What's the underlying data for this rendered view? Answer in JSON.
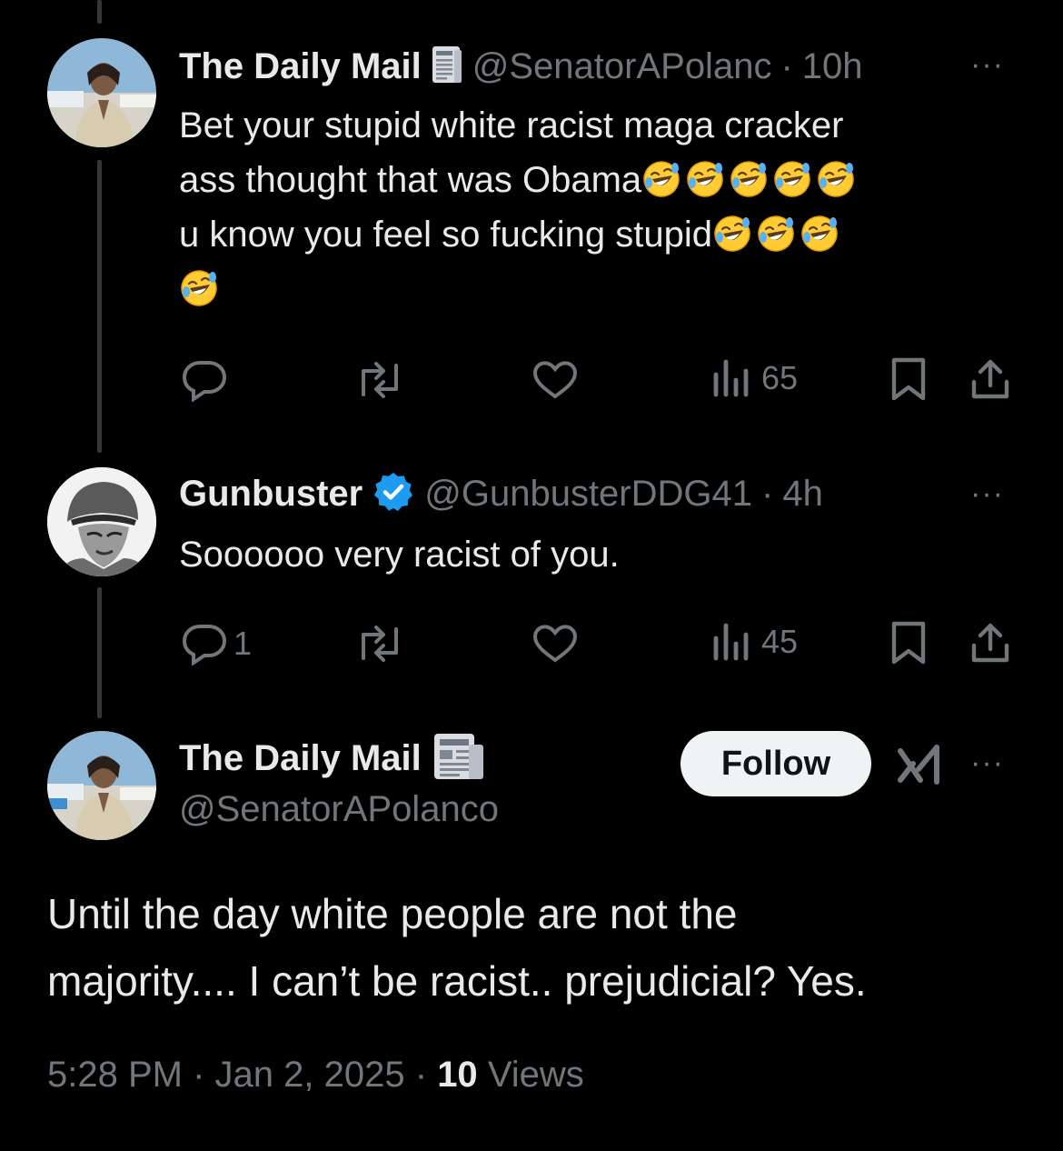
{
  "tweet1": {
    "name": "The Daily Mail",
    "badge_icon": "newspaper-icon",
    "handle": "@SenatorAPolanc",
    "sep": "·",
    "time": "10h",
    "more": "···",
    "lines": [
      "Bet your stupid white racist maga cracker",
      "ass thought that was Obama",
      "u know you feel so fucking stupid"
    ],
    "emoji": "🤣",
    "emoji_counts": [
      0,
      5,
      3,
      1
    ],
    "actions": {
      "replies": "",
      "reposts": "",
      "likes": "",
      "views": "65"
    }
  },
  "tweet2": {
    "name": "Gunbuster",
    "badge_icon": "verified-badge-icon",
    "verified_color": "#1d9bf0",
    "handle": "@GunbusterDDG41",
    "sep": "·",
    "time": "4h",
    "more": "···",
    "text": "Soooooo very racist of you.",
    "actions": {
      "replies": "1",
      "reposts": "",
      "likes": "",
      "views": "45"
    }
  },
  "main": {
    "name": "The Daily Mail",
    "badge_icon": "newspaper-icon",
    "handle": "@SenatorAPolanco",
    "follow_label": "Follow",
    "grok_icon": "grok-icon",
    "more": "···",
    "text_line1": "Until the day white people are not the",
    "text_line2": "majority.... I can’t be racist.. prejudicial? Yes.",
    "time": "5:28 PM",
    "sep1": "·",
    "date": "Jan 2, 2025",
    "sep2": "·",
    "views_count": "10",
    "views_label": "Views"
  },
  "colors": {
    "background": "#000000",
    "text": "#e7e9ea",
    "muted": "#71767b",
    "thread_line": "#333639",
    "follow_bg": "#eff3f4"
  }
}
